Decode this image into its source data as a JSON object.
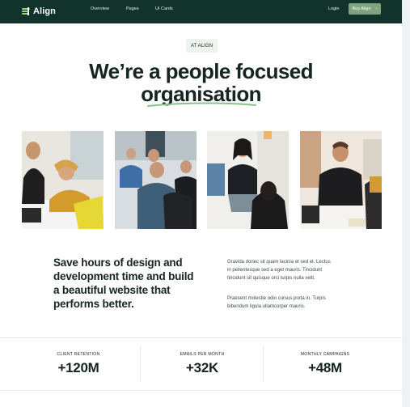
{
  "header": {
    "logo_text": "Align",
    "nav": [
      "Overview",
      "Pages",
      "UI Cards"
    ],
    "login_label": "Login",
    "buy_label": "Buy Align",
    "buy_arrow": "›"
  },
  "hero": {
    "badge": "AT ALIGN",
    "title_line1": "We’re a people focused",
    "title_line2": "organisation"
  },
  "photos": [
    {
      "name": "team-photo-1"
    },
    {
      "name": "team-photo-2"
    },
    {
      "name": "team-photo-3"
    },
    {
      "name": "team-photo-4"
    }
  ],
  "about": {
    "heading_lines": [
      "Save hours of design and",
      "development time and build",
      "a beautiful website that",
      "performs better."
    ],
    "paragraph1_lines": [
      "Gravida donec sit quam lacinia et sed et. Lectus",
      "in pellentesque sed a eget mauris. Tincidunt",
      "tincidunt sit quisque orci turpis nulla velit."
    ],
    "paragraph2_lines": [
      "Praesent molestie odio cursus porta in. Turpis",
      "bibendum ligula ullamcorper mauris."
    ]
  },
  "stats": [
    {
      "label": "CLIENT RETENTION",
      "value": "+120M"
    },
    {
      "label": "EMAILS PER MONTH",
      "value": "+32K"
    },
    {
      "label": "MONTHLY CAMPAIGNS",
      "value": "+48M"
    }
  ],
  "colors": {
    "header_bg": "#12332c",
    "accent_green": "#7fa37e",
    "text_dark": "#16251f"
  }
}
